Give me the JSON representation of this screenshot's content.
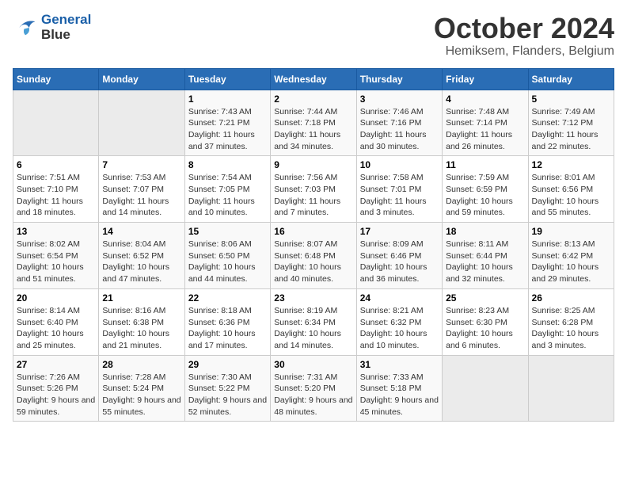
{
  "header": {
    "logo_line1": "General",
    "logo_line2": "Blue",
    "month_title": "October 2024",
    "subtitle": "Hemiksem, Flanders, Belgium"
  },
  "days_of_week": [
    "Sunday",
    "Monday",
    "Tuesday",
    "Wednesday",
    "Thursday",
    "Friday",
    "Saturday"
  ],
  "weeks": [
    [
      {
        "day": "",
        "sunrise": "",
        "sunset": "",
        "daylight": ""
      },
      {
        "day": "",
        "sunrise": "",
        "sunset": "",
        "daylight": ""
      },
      {
        "day": "1",
        "sunrise": "Sunrise: 7:43 AM",
        "sunset": "Sunset: 7:21 PM",
        "daylight": "Daylight: 11 hours and 37 minutes."
      },
      {
        "day": "2",
        "sunrise": "Sunrise: 7:44 AM",
        "sunset": "Sunset: 7:18 PM",
        "daylight": "Daylight: 11 hours and 34 minutes."
      },
      {
        "day": "3",
        "sunrise": "Sunrise: 7:46 AM",
        "sunset": "Sunset: 7:16 PM",
        "daylight": "Daylight: 11 hours and 30 minutes."
      },
      {
        "day": "4",
        "sunrise": "Sunrise: 7:48 AM",
        "sunset": "Sunset: 7:14 PM",
        "daylight": "Daylight: 11 hours and 26 minutes."
      },
      {
        "day": "5",
        "sunrise": "Sunrise: 7:49 AM",
        "sunset": "Sunset: 7:12 PM",
        "daylight": "Daylight: 11 hours and 22 minutes."
      }
    ],
    [
      {
        "day": "6",
        "sunrise": "Sunrise: 7:51 AM",
        "sunset": "Sunset: 7:10 PM",
        "daylight": "Daylight: 11 hours and 18 minutes."
      },
      {
        "day": "7",
        "sunrise": "Sunrise: 7:53 AM",
        "sunset": "Sunset: 7:07 PM",
        "daylight": "Daylight: 11 hours and 14 minutes."
      },
      {
        "day": "8",
        "sunrise": "Sunrise: 7:54 AM",
        "sunset": "Sunset: 7:05 PM",
        "daylight": "Daylight: 11 hours and 10 minutes."
      },
      {
        "day": "9",
        "sunrise": "Sunrise: 7:56 AM",
        "sunset": "Sunset: 7:03 PM",
        "daylight": "Daylight: 11 hours and 7 minutes."
      },
      {
        "day": "10",
        "sunrise": "Sunrise: 7:58 AM",
        "sunset": "Sunset: 7:01 PM",
        "daylight": "Daylight: 11 hours and 3 minutes."
      },
      {
        "day": "11",
        "sunrise": "Sunrise: 7:59 AM",
        "sunset": "Sunset: 6:59 PM",
        "daylight": "Daylight: 10 hours and 59 minutes."
      },
      {
        "day": "12",
        "sunrise": "Sunrise: 8:01 AM",
        "sunset": "Sunset: 6:56 PM",
        "daylight": "Daylight: 10 hours and 55 minutes."
      }
    ],
    [
      {
        "day": "13",
        "sunrise": "Sunrise: 8:02 AM",
        "sunset": "Sunset: 6:54 PM",
        "daylight": "Daylight: 10 hours and 51 minutes."
      },
      {
        "day": "14",
        "sunrise": "Sunrise: 8:04 AM",
        "sunset": "Sunset: 6:52 PM",
        "daylight": "Daylight: 10 hours and 47 minutes."
      },
      {
        "day": "15",
        "sunrise": "Sunrise: 8:06 AM",
        "sunset": "Sunset: 6:50 PM",
        "daylight": "Daylight: 10 hours and 44 minutes."
      },
      {
        "day": "16",
        "sunrise": "Sunrise: 8:07 AM",
        "sunset": "Sunset: 6:48 PM",
        "daylight": "Daylight: 10 hours and 40 minutes."
      },
      {
        "day": "17",
        "sunrise": "Sunrise: 8:09 AM",
        "sunset": "Sunset: 6:46 PM",
        "daylight": "Daylight: 10 hours and 36 minutes."
      },
      {
        "day": "18",
        "sunrise": "Sunrise: 8:11 AM",
        "sunset": "Sunset: 6:44 PM",
        "daylight": "Daylight: 10 hours and 32 minutes."
      },
      {
        "day": "19",
        "sunrise": "Sunrise: 8:13 AM",
        "sunset": "Sunset: 6:42 PM",
        "daylight": "Daylight: 10 hours and 29 minutes."
      }
    ],
    [
      {
        "day": "20",
        "sunrise": "Sunrise: 8:14 AM",
        "sunset": "Sunset: 6:40 PM",
        "daylight": "Daylight: 10 hours and 25 minutes."
      },
      {
        "day": "21",
        "sunrise": "Sunrise: 8:16 AM",
        "sunset": "Sunset: 6:38 PM",
        "daylight": "Daylight: 10 hours and 21 minutes."
      },
      {
        "day": "22",
        "sunrise": "Sunrise: 8:18 AM",
        "sunset": "Sunset: 6:36 PM",
        "daylight": "Daylight: 10 hours and 17 minutes."
      },
      {
        "day": "23",
        "sunrise": "Sunrise: 8:19 AM",
        "sunset": "Sunset: 6:34 PM",
        "daylight": "Daylight: 10 hours and 14 minutes."
      },
      {
        "day": "24",
        "sunrise": "Sunrise: 8:21 AM",
        "sunset": "Sunset: 6:32 PM",
        "daylight": "Daylight: 10 hours and 10 minutes."
      },
      {
        "day": "25",
        "sunrise": "Sunrise: 8:23 AM",
        "sunset": "Sunset: 6:30 PM",
        "daylight": "Daylight: 10 hours and 6 minutes."
      },
      {
        "day": "26",
        "sunrise": "Sunrise: 8:25 AM",
        "sunset": "Sunset: 6:28 PM",
        "daylight": "Daylight: 10 hours and 3 minutes."
      }
    ],
    [
      {
        "day": "27",
        "sunrise": "Sunrise: 7:26 AM",
        "sunset": "Sunset: 5:26 PM",
        "daylight": "Daylight: 9 hours and 59 minutes."
      },
      {
        "day": "28",
        "sunrise": "Sunrise: 7:28 AM",
        "sunset": "Sunset: 5:24 PM",
        "daylight": "Daylight: 9 hours and 55 minutes."
      },
      {
        "day": "29",
        "sunrise": "Sunrise: 7:30 AM",
        "sunset": "Sunset: 5:22 PM",
        "daylight": "Daylight: 9 hours and 52 minutes."
      },
      {
        "day": "30",
        "sunrise": "Sunrise: 7:31 AM",
        "sunset": "Sunset: 5:20 PM",
        "daylight": "Daylight: 9 hours and 48 minutes."
      },
      {
        "day": "31",
        "sunrise": "Sunrise: 7:33 AM",
        "sunset": "Sunset: 5:18 PM",
        "daylight": "Daylight: 9 hours and 45 minutes."
      },
      {
        "day": "",
        "sunrise": "",
        "sunset": "",
        "daylight": ""
      },
      {
        "day": "",
        "sunrise": "",
        "sunset": "",
        "daylight": ""
      }
    ]
  ]
}
